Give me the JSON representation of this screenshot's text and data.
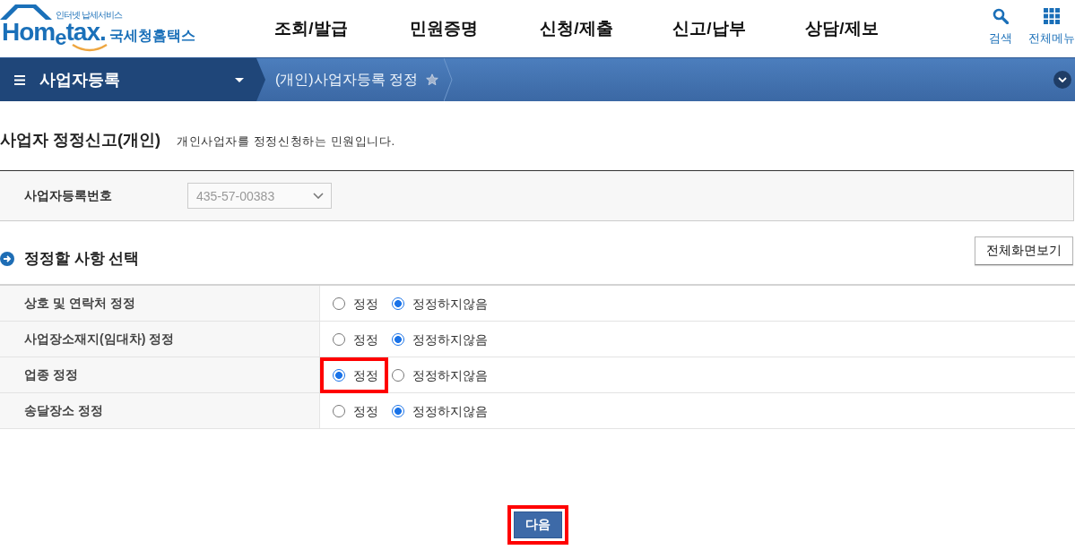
{
  "header": {
    "logo": {
      "tagline": "인터넷 납세서비스",
      "wordmark": "Hom$_{e}$tax.",
      "name": "국세청홈택스"
    },
    "nav": [
      "조회/발급",
      "민원증명",
      "신청/제출",
      "신고/납부",
      "상담/제보"
    ],
    "tools": [
      {
        "kind": "search",
        "label": "검색"
      },
      {
        "kind": "menu",
        "label": "전체메뉴"
      }
    ]
  },
  "breadcrumb": {
    "category": "사업자등록",
    "current": "(개인)사업자등록 정정"
  },
  "page": {
    "title": "사업자 정정신고(개인)",
    "description": "개인사업자를 정정신청하는 민원입니다."
  },
  "business_number": {
    "label": "사업자등록번호",
    "value": "435-57-00383",
    "disabled": true
  },
  "section": {
    "title": "정정할 사항 선택",
    "button": "전체화면보기"
  },
  "items": [
    {
      "label": "상호 및 연락처 정정",
      "options": [
        {
          "label": "정정",
          "selected": false,
          "highlighted": false
        },
        {
          "label": "정정하지않음",
          "selected": true,
          "highlighted": false
        }
      ]
    },
    {
      "label": "사업장소재지(임대차) 정정",
      "options": [
        {
          "label": "정정",
          "selected": false,
          "highlighted": false
        },
        {
          "label": "정정하지않음",
          "selected": true,
          "highlighted": false
        }
      ]
    },
    {
      "label": "업종 정정",
      "options": [
        {
          "label": "정정",
          "selected": true,
          "highlighted": true
        },
        {
          "label": "정정하지않음",
          "selected": false,
          "highlighted": false
        }
      ]
    },
    {
      "label": "송달장소 정정",
      "options": [
        {
          "label": "정정",
          "selected": false,
          "highlighted": false
        },
        {
          "label": "정정하지않음",
          "selected": true,
          "highlighted": false
        }
      ]
    }
  ],
  "next_button": {
    "label": "다음",
    "highlighted": true
  }
}
